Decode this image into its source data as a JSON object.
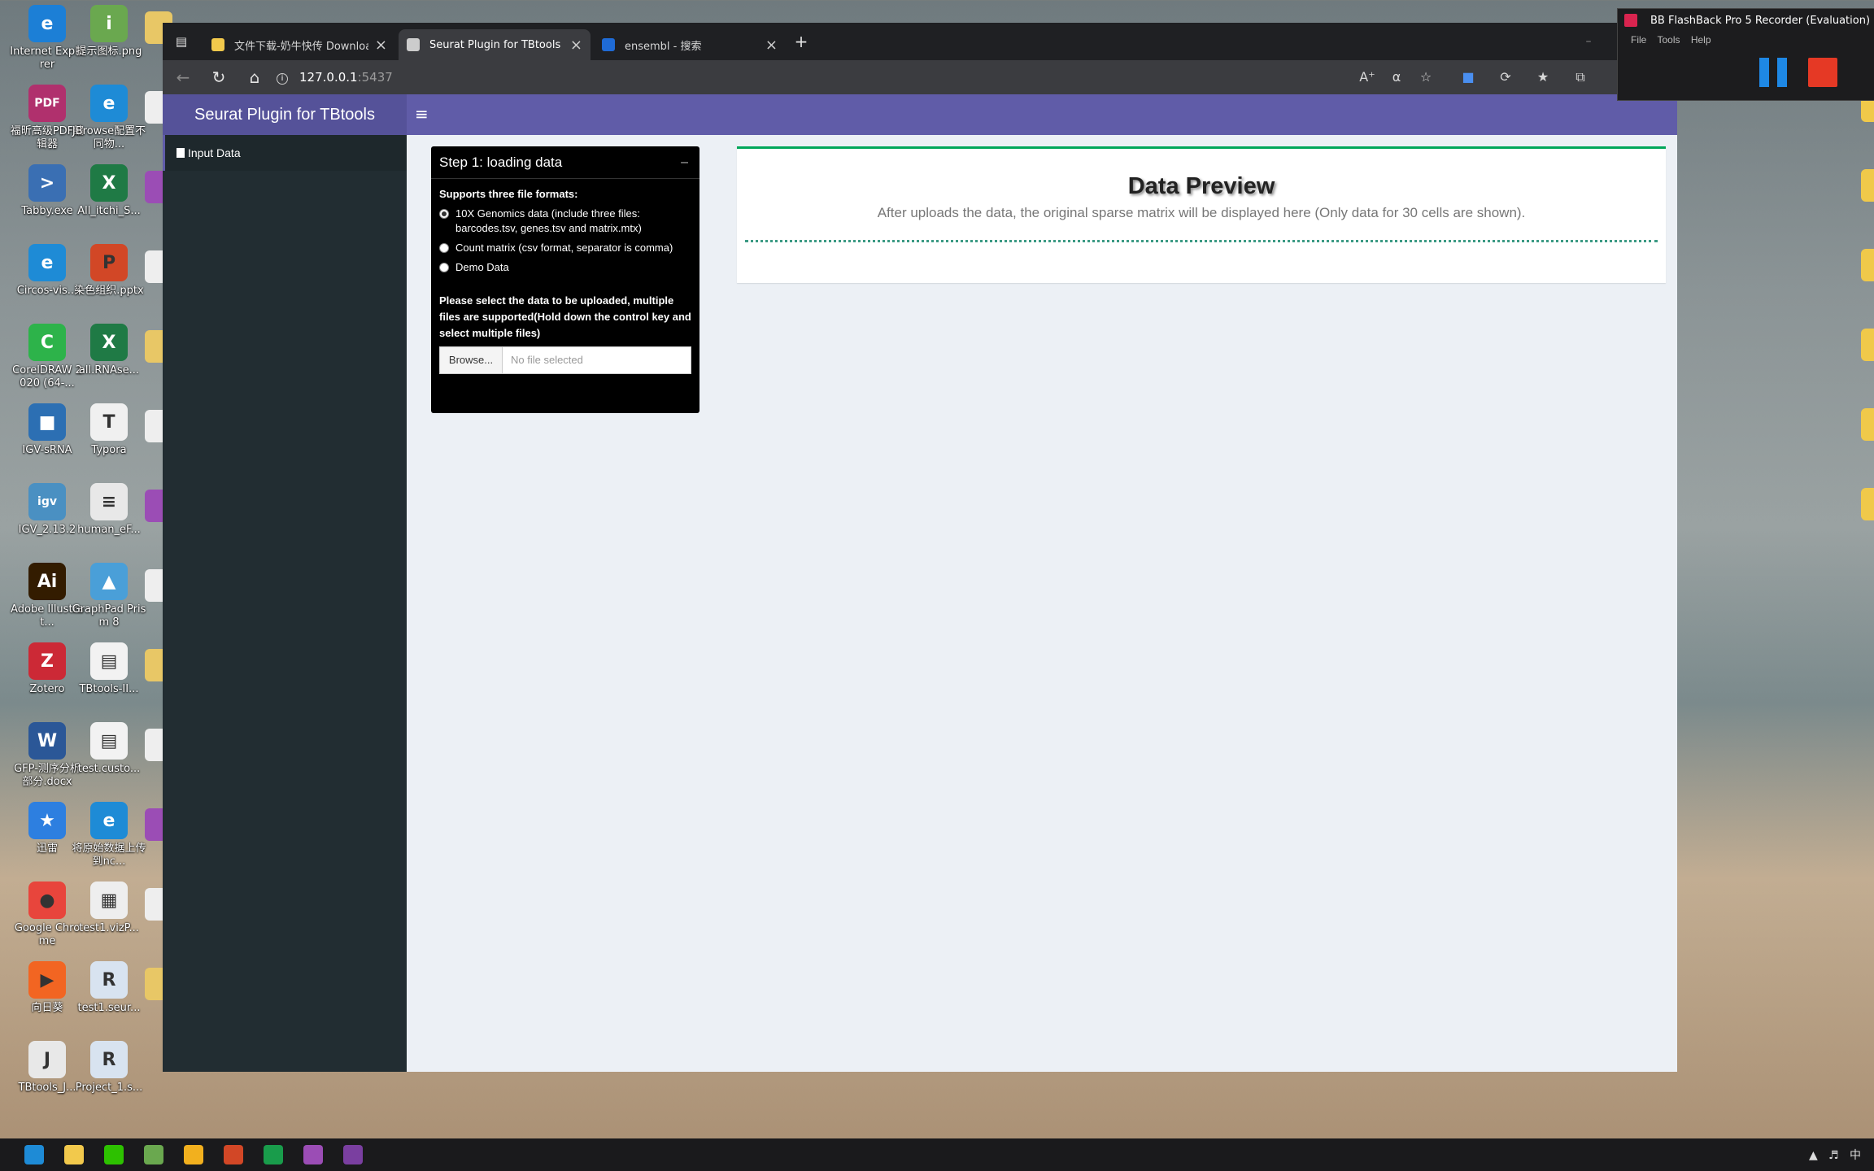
{
  "desktop": {
    "icons": [
      {
        "label": "Internet Explorer",
        "glyph": "e",
        "color": "#1c7fd6"
      },
      {
        "label": "提示图标.png",
        "glyph": "i",
        "color": "#6aa84f"
      },
      {
        "label": "福昕高级PDF编辑器",
        "glyph": "PDF",
        "color": "#b0306d"
      },
      {
        "label": "JBrowse配置不同物...",
        "glyph": "e",
        "color": "#1e8bd6"
      },
      {
        "label": "Tabby.exe",
        "glyph": ">",
        "color": "#3a6fb3"
      },
      {
        "label": "All_itchi_S...",
        "glyph": "X",
        "color": "#1f7a45"
      },
      {
        "label": "Circos-vis...",
        "glyph": "e",
        "color": "#1e8bd6"
      },
      {
        "label": "染色组织.pptx",
        "glyph": "P",
        "color": "#d24726"
      },
      {
        "label": "CorelDRAW 2020 (64-...",
        "glyph": "C",
        "color": "#2db34a"
      },
      {
        "label": "all.RNAse...",
        "glyph": "X",
        "color": "#1f7a45"
      },
      {
        "label": "IGV-sRNA",
        "glyph": "■",
        "color": "#2c6fb3"
      },
      {
        "label": "Typora",
        "glyph": "T",
        "color": "#f0f0f0"
      },
      {
        "label": "IGV_2.13.2",
        "glyph": "igv",
        "color": "#4a90c2"
      },
      {
        "label": "human_eF...",
        "glyph": "≡",
        "color": "#e8e8e8"
      },
      {
        "label": "Adobe Illustrat...",
        "glyph": "Ai",
        "color": "#331c00"
      },
      {
        "label": "GraphPad Prism 8",
        "glyph": "▲",
        "color": "#4a9fd8"
      },
      {
        "label": "Zotero",
        "glyph": "Z",
        "color": "#cc2936"
      },
      {
        "label": "TBtools-II...",
        "glyph": "▤",
        "color": "#f2f2f2"
      },
      {
        "label": "GFP-测序分析部分.docx",
        "glyph": "W",
        "color": "#2b5797"
      },
      {
        "label": "test.custo...",
        "glyph": "▤",
        "color": "#f2f2f2"
      },
      {
        "label": "迅雷",
        "glyph": "★",
        "color": "#2d7fe0"
      },
      {
        "label": "将原始数据上传到nc...",
        "glyph": "e",
        "color": "#1e8bd6"
      },
      {
        "label": "Google Chrome",
        "glyph": "●",
        "color": "#e8453c"
      },
      {
        "label": "test1.vizP...",
        "glyph": "▦",
        "color": "#eeeeee"
      },
      {
        "label": "向日葵",
        "glyph": "▶",
        "color": "#f26522"
      },
      {
        "label": "test1.seur...",
        "glyph": "R",
        "color": "#d8e3f0"
      },
      {
        "label": "TBtools_J...",
        "glyph": "J",
        "color": "#e8e8e8"
      },
      {
        "label": "Project_1.s...",
        "glyph": "R",
        "color": "#d8e3f0"
      }
    ]
  },
  "browser": {
    "tabs": [
      {
        "title": "文件下载-奶牛快传 Download",
        "close": "×",
        "active": false,
        "icon_color": "#f2c94c"
      },
      {
        "title": "Seurat Plugin for TBtools",
        "close": "×",
        "active": true,
        "icon_color": "#cccccc"
      },
      {
        "title": "ensembl - 搜索",
        "close": "×",
        "active": false,
        "icon_color": "#1f6bd6"
      }
    ],
    "new_tab": "+",
    "url_host": "127.0.0.1",
    "url_port": ":5437",
    "icons": [
      "back-icon",
      "refresh-icon",
      "home-icon",
      "info-icon",
      "read-aloud-icon",
      "translate-icon",
      "favorite-add-icon",
      "extension-icon",
      "sync-icon",
      "favorites-icon",
      "collections-icon"
    ]
  },
  "app": {
    "title": "Seurat Plugin for TBtools",
    "menu_glyph": "≡",
    "sidebar": {
      "items": [
        {
          "label": "Input Data"
        }
      ]
    },
    "step1": {
      "title": "Step 1: loading data",
      "collapse_glyph": "–",
      "formats_heading": "Supports three file formats:",
      "options": [
        {
          "label": "10X Genomics data (include three files: barcodes.tsv, genes.tsv and matrix.mtx)",
          "checked": true
        },
        {
          "label": "Count matrix (csv format, separator is comma)",
          "checked": false
        },
        {
          "label": "Demo Data",
          "checked": false
        }
      ],
      "upload_label": "Please select the data to be uploaded, multiple files are supported(Hold down the control key and select multiple files)",
      "browse_label": "Browse...",
      "file_placeholder": "No file selected"
    },
    "preview": {
      "title": "Data Preview",
      "description": "After uploads the data, the original sparse matrix will be displayed here (Only data for 30 cells are shown)."
    }
  },
  "recorder": {
    "title": "BB FlashBack Pro 5 Recorder (Evaluation)",
    "menu": [
      "File",
      "Tools",
      "Help"
    ]
  },
  "taskbar": {
    "tray_text": "中",
    "apps": [
      {
        "name": "edge",
        "color": "#1e8bd6"
      },
      {
        "name": "file-explorer",
        "color": "#f2c94c"
      },
      {
        "name": "wechat",
        "color": "#2dc100"
      },
      {
        "name": "notepad",
        "color": "#6aa84f"
      },
      {
        "name": "excel-grid",
        "color": "#f2b01e"
      },
      {
        "name": "powerpoint",
        "color": "#d24726"
      },
      {
        "name": "vim",
        "color": "#199c4b"
      },
      {
        "name": "flashback-recorder",
        "color": "#9b4db5"
      },
      {
        "name": "flashback-player",
        "color": "#7a3fa0"
      }
    ]
  }
}
